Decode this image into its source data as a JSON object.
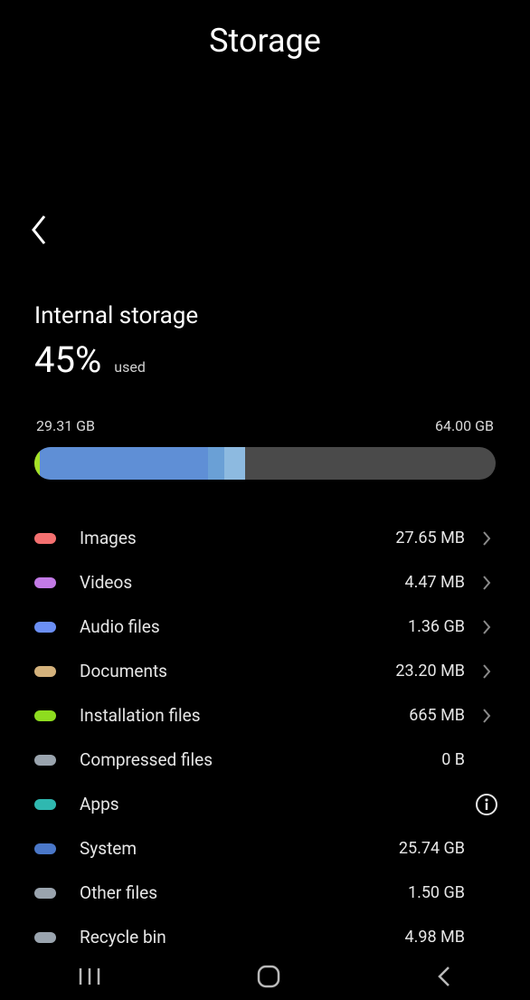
{
  "header": {
    "title": "Storage"
  },
  "summary": {
    "title": "Internal storage",
    "percent": "45%",
    "used_label": "used",
    "used_gb": "29.31 GB",
    "total_gb": "64.00 GB"
  },
  "bar_segments": [
    {
      "color": "#a5e227",
      "percent": 1.2
    },
    {
      "color": "#5f8fd6",
      "percent": 36.5
    },
    {
      "color": "#6aa0d6",
      "percent": 3.5
    },
    {
      "color": "#8dbae0",
      "percent": 4.5
    }
  ],
  "categories": [
    {
      "label": "Images",
      "value": "27.65 MB",
      "color": "#f47070",
      "trail": "chevron"
    },
    {
      "label": "Videos",
      "value": "4.47 MB",
      "color": "#c37ae6",
      "trail": "chevron"
    },
    {
      "label": "Audio files",
      "value": "1.36 GB",
      "color": "#6b8ff5",
      "trail": "chevron"
    },
    {
      "label": "Documents",
      "value": "23.20 MB",
      "color": "#d4b27c",
      "trail": "chevron"
    },
    {
      "label": "Installation files",
      "value": "665 MB",
      "color": "#8edc1f",
      "trail": "chevron"
    },
    {
      "label": "Compressed files",
      "value": "0 B",
      "color": "#9aa4ae",
      "trail": "none"
    },
    {
      "label": "Apps",
      "value": "",
      "color": "#2fb8b0",
      "trail": "info"
    },
    {
      "label": "System",
      "value": "25.74 GB",
      "color": "#4a77c8",
      "trail": "none"
    },
    {
      "label": "Other files",
      "value": "1.50 GB",
      "color": "#9aa4ae",
      "trail": "none"
    },
    {
      "label": "Recycle bin",
      "value": "4.98 MB",
      "color": "#9aa4ae",
      "trail": "none"
    }
  ]
}
